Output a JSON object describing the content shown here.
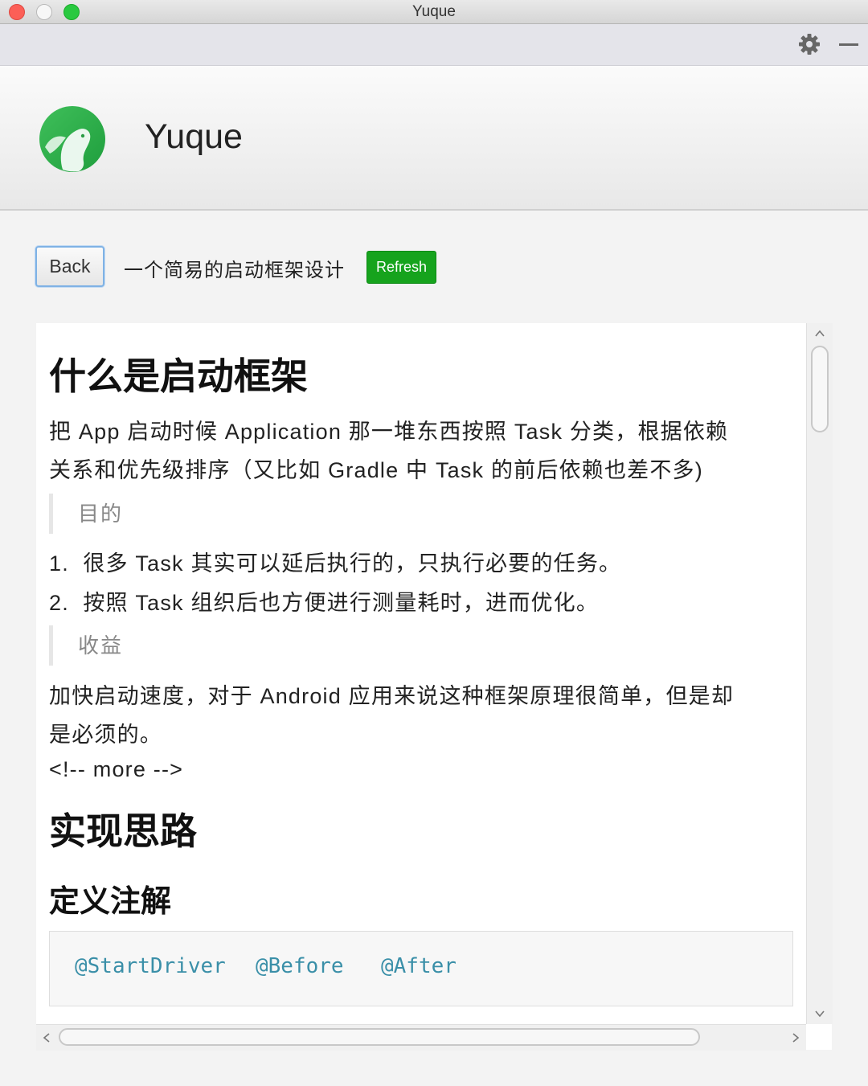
{
  "window": {
    "title": "Yuque"
  },
  "toolbar": {
    "settings_icon": "gear-icon",
    "minimize_icon": "minus-icon"
  },
  "header": {
    "app_name": "Yuque",
    "logo_icon": "yuque-bird-logo"
  },
  "actions": {
    "back_label": "Back",
    "doc_title": "一个简易的启动框架设计",
    "refresh_label": "Refresh",
    "refresh_color": "#16a31d"
  },
  "article": {
    "heading1": "什么是启动框架",
    "para1_line1": "把 App 启动时候 Application 那一堆东西按照 Task 分类，根据依赖",
    "para1_line2": "关系和优先级排序（又比如 Gradle 中 Task 的前后依赖也差不多)",
    "quote1": "目的",
    "list": [
      {
        "num": "1.",
        "text": "很多 Task 其实可以延后执行的，只执行必要的任务。"
      },
      {
        "num": "2.",
        "text": "按照 Task 组织后也方便进行测量耗时，进而优化。"
      }
    ],
    "quote2": "收益",
    "para2_line1": "加快启动速度，对于 Android 应用来说这种框架原理很简单，但是却",
    "para2_line2": "是必须的。",
    "comment": "<!-- more -->",
    "heading2": "实现思路",
    "heading3": "定义注解",
    "code": [
      "@StartDriver",
      "@Before",
      "@After"
    ]
  }
}
